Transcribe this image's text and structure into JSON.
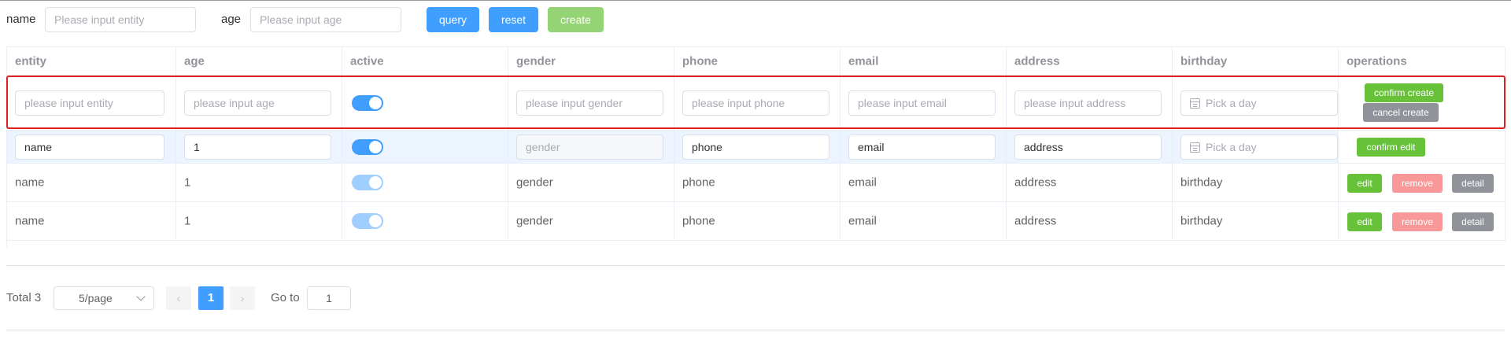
{
  "search": {
    "name_label": "name",
    "name_placeholder": "Please input entity",
    "age_label": "age",
    "age_placeholder": "Please input age",
    "query_label": "query",
    "reset_label": "reset",
    "create_label": "create"
  },
  "table": {
    "columns": [
      "entity",
      "age",
      "active",
      "gender",
      "phone",
      "email",
      "address",
      "birthday",
      "operations"
    ],
    "create_row": {
      "entity_placeholder": "please input entity",
      "age_placeholder": "please input age",
      "active": true,
      "gender_placeholder": "please input gender",
      "phone_placeholder": "please input phone",
      "email_placeholder": "please input email",
      "address_placeholder": "please input address",
      "birthday_placeholder": "Pick a day",
      "confirm_label": "confirm create",
      "cancel_label": "cancel create"
    },
    "edit_row": {
      "entity": "name",
      "age": "1",
      "active": true,
      "gender_placeholder": "gender",
      "phone": "phone",
      "email": "email",
      "address": "address",
      "birthday_placeholder": "Pick a day",
      "confirm_label": "confirm edit"
    },
    "rows": [
      {
        "entity": "name",
        "age": "1",
        "active": true,
        "gender": "gender",
        "phone": "phone",
        "email": "email",
        "address": "address",
        "birthday": "birthday"
      },
      {
        "entity": "name",
        "age": "1",
        "active": true,
        "gender": "gender",
        "phone": "phone",
        "email": "email",
        "address": "address",
        "birthday": "birthday"
      }
    ],
    "row_actions": {
      "edit": "edit",
      "remove": "remove",
      "detail": "detail"
    }
  },
  "pagination": {
    "total_text": "Total 3",
    "page_size": "5/page",
    "current_page": "1",
    "goto_label": "Go to",
    "goto_value": "1",
    "prev_icon": "‹",
    "next_icon": "›"
  },
  "colors": {
    "primary": "#409eff",
    "success": "#67c23a",
    "danger_light": "#f89898",
    "info": "#909399",
    "highlight_border": "#e02020"
  }
}
